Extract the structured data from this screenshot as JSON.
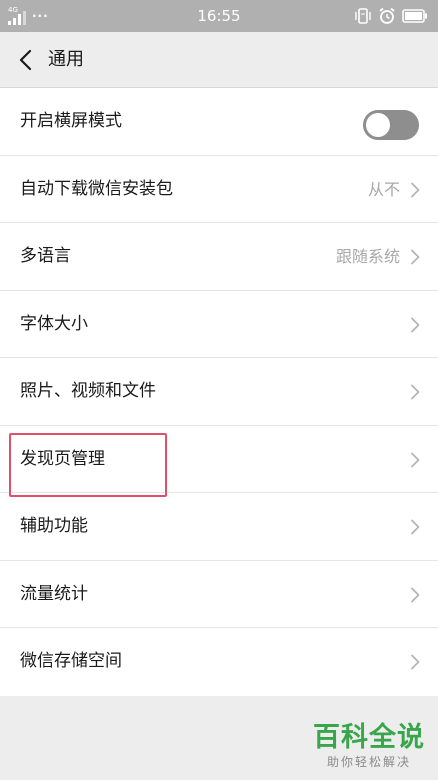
{
  "status_bar": {
    "network": "4G",
    "time": "16:55",
    "dots": "···"
  },
  "header": {
    "title": "通用"
  },
  "rows": [
    {
      "label": "开启横屏模式",
      "type": "toggle",
      "toggle_on": false
    },
    {
      "label": "自动下载微信安装包",
      "value": "从不"
    },
    {
      "label": "多语言",
      "value": "跟随系统"
    },
    {
      "label": "字体大小"
    },
    {
      "label": "照片、视频和文件"
    },
    {
      "label": "发现页管理",
      "highlighted": true
    },
    {
      "label": "辅助功能"
    },
    {
      "label": "流量统计"
    },
    {
      "label": "微信存储空间"
    }
  ],
  "watermark": {
    "main": "百科全说",
    "sub": "助你轻松解决"
  },
  "colors": {
    "status_bar": "#b0b0b0",
    "background": "#ededed",
    "toggle_off": "#8e8e8e",
    "highlight": "#e0506a",
    "watermark_green": "#3aa64c"
  }
}
